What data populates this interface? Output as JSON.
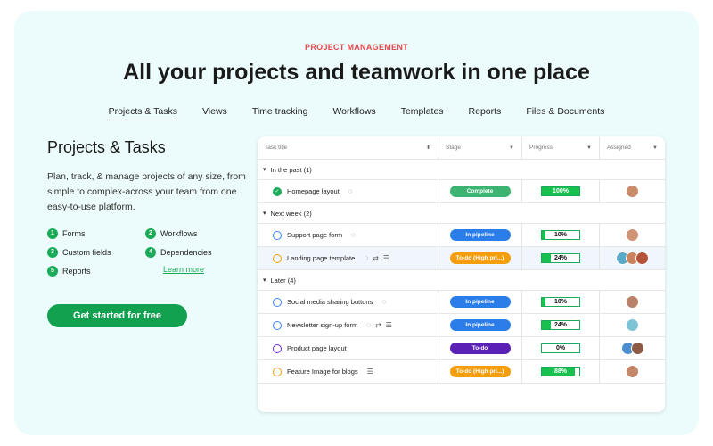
{
  "eyebrow": "PROJECT MANAGEMENT",
  "headline": "All your projects and teamwork in one place",
  "tabs": [
    {
      "label": "Projects & Tasks",
      "active": true
    },
    {
      "label": "Views"
    },
    {
      "label": "Time tracking"
    },
    {
      "label": "Workflows"
    },
    {
      "label": "Templates"
    },
    {
      "label": "Reports"
    },
    {
      "label": "Files & Documents"
    }
  ],
  "left": {
    "title": "Projects & Tasks",
    "description": "Plan, track, & manage projects of any size, from simple to complex-across your team from one easy-to-use platform.",
    "features": [
      {
        "num": "1",
        "label": "Forms"
      },
      {
        "num": "2",
        "label": "Workflows"
      },
      {
        "num": "3",
        "label": "Custom fields"
      },
      {
        "num": "4",
        "label": "Dependencies"
      },
      {
        "num": "5",
        "label": "Reports"
      }
    ],
    "learn_more": "Learn more",
    "cta": "Get started for free"
  },
  "table": {
    "headers": [
      "Task title",
      "Stage",
      "Progress",
      "Assigned"
    ],
    "groups": [
      {
        "label": "In the past (1)",
        "rows": [
          {
            "title": "Homepage layout",
            "status": "done",
            "icons": [
              "💬"
            ],
            "stage": "Complete",
            "stage_color": "#3cb371",
            "progress": 100,
            "progress_label": "100%",
            "avatars": [
              "#c98c6b"
            ]
          }
        ]
      },
      {
        "label": "Next week (2)",
        "rows": [
          {
            "title": "Support page form",
            "status": "#3b82f6",
            "icons": [
              "💬"
            ],
            "stage": "In pipeline",
            "stage_color": "#2b7de9",
            "progress": 10,
            "progress_label": "10%",
            "avatars": [
              "#d09474"
            ]
          },
          {
            "title": "Landing page template",
            "status": "#f59e0b",
            "icons": [
              "💬",
              "⇄",
              "☰"
            ],
            "stage": "To-do (High pri...)",
            "stage_color": "#f59e0b",
            "progress": 24,
            "progress_label": "24%",
            "avatars": [
              "#5aa9c9",
              "#c9845f",
              "#b5533a"
            ],
            "highlight": true
          }
        ]
      },
      {
        "label": "Later (4)",
        "rows": [
          {
            "title": "Social media sharing buttons",
            "status": "#3b82f6",
            "icons": [
              "💬"
            ],
            "stage": "In pipeline",
            "stage_color": "#2b7de9",
            "progress": 10,
            "progress_label": "10%",
            "avatars": [
              "#b9826a"
            ]
          },
          {
            "title": "Newsletter sign-up form",
            "status": "#3b82f6",
            "icons": [
              "💬",
              "⇄",
              "☰"
            ],
            "stage": "In pipeline",
            "stage_color": "#2b7de9",
            "progress": 24,
            "progress_label": "24%",
            "avatars": [
              "#7fc4d6"
            ]
          },
          {
            "title": "Product page layout",
            "status": "#6d28d9",
            "icons": [],
            "stage": "To-do",
            "stage_color": "#5b21b6",
            "progress": 0,
            "progress_label": "0%",
            "avatars": [
              "#4b8fd1",
              "#8c5a45"
            ]
          },
          {
            "title": "Feature Image for blogs",
            "status": "#f59e0b",
            "icons": [
              "☰"
            ],
            "stage": "To-do (High pri...)",
            "stage_color": "#f59e0b",
            "progress": 88,
            "progress_label": "88%",
            "avatars": [
              "#c48769"
            ]
          }
        ]
      }
    ]
  }
}
